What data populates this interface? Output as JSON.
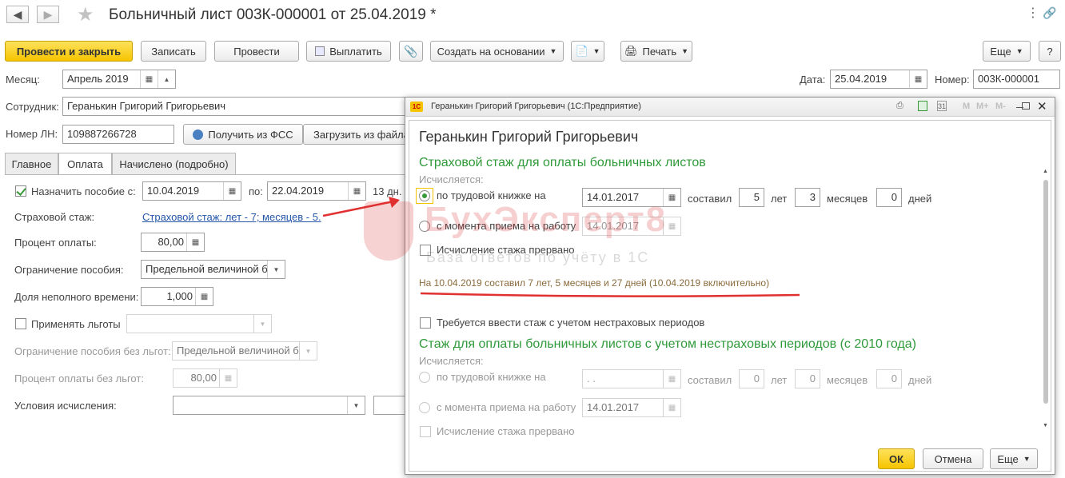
{
  "window": {
    "title": "Больничный лист 003К-000001 от 25.04.2019 *"
  },
  "toolbar": {
    "post_close": "Провести и закрыть",
    "save": "Записать",
    "post": "Провести",
    "pay": "Выплатить",
    "create_based": "Создать на основании",
    "print": "Печать",
    "more": "Еще",
    "help": "?"
  },
  "header": {
    "month_label": "Месяц:",
    "month_value": "Апрель 2019",
    "date_label": "Дата:",
    "date_value": "25.04.2019",
    "number_label": "Номер:",
    "number_value": "003К-000001",
    "employee_label": "Сотрудник:",
    "employee_value": "Геранькин Григорий Григорьевич",
    "ln_label": "Номер ЛН:",
    "ln_value": "109887266728",
    "get_fss": "Получить из ФСС",
    "load_file": "Загрузить из файла"
  },
  "tabs": [
    "Главное",
    "Оплата",
    "Начислено (подробно)"
  ],
  "payment": {
    "assign_label": "Назначить пособие с:",
    "assign_from": "10.04.2019",
    "to_label": "по:",
    "assign_to": "22.04.2019",
    "days": "13 дн.",
    "insurance_label": "Страховой стаж:",
    "insurance_link": "Страховой стаж: лет - 7; месяцев - 5.",
    "percent_label": "Процент оплаты:",
    "percent_value": "80,00",
    "limit_label": "Ограничение пособия:",
    "limit_value": "Предельной величиной ба",
    "parttime_label": "Доля неполного времени:",
    "parttime_value": "1,000",
    "benefits_label": "Применять льготы",
    "limit_nobenefit_label": "Ограничение пособия без льгот:",
    "limit_nobenefit_value": "Предельной величиной ба",
    "percent_nobenefit_label": "Процент оплаты без льгот:",
    "percent_nobenefit_value": "80,00",
    "conditions_label": "Условия исчисления:"
  },
  "dialog": {
    "title": "Геранькин Григорий Григорьевич  (1С:Предприятие)",
    "heading": "Геранькин Григорий Григорьевич",
    "section1": "Страховой стаж для оплаты больничных листов",
    "calculated": "Исчисляется:",
    "by_workbook": "по трудовой книжке на",
    "workbook_date": "14.01.2017",
    "made": "составил",
    "years_value": "5",
    "years_label": "лет",
    "months_value": "3",
    "months_label": "месяцев",
    "days_value": "0",
    "days_label": "дней",
    "from_hire": "с момента приема на работу",
    "hire_date": "14.01.2017",
    "interrupted": "Исчисление стажа прервано",
    "summary": "На 10.04.2019 составил 7 лет, 5 месяцев и 27 дней (10.04.2019 включительно)",
    "need_noninsurance": "Требуется ввести стаж с учетом нестраховых периодов",
    "section2": "Стаж для оплаты больничных листов с учетом нестраховых периодов (с 2010 года)",
    "calculated2": "Исчисляется:",
    "by_workbook2": "по трудовой книжке на",
    "workbook_date2": ". .",
    "made2": "составил",
    "years_value2": "0",
    "years_label2": "лет",
    "months_value2": "0",
    "months_label2": "месяцев",
    "days_value2": "0",
    "days_label2": "дней",
    "from_hire2": "с момента приема на работу",
    "hire_date2": "14.01.2017",
    "interrupted2": "Исчисление стажа прервано",
    "ok": "ОК",
    "cancel": "Отмена",
    "more": "Еще"
  },
  "watermark": {
    "brand": "БухЭксперт8",
    "tagline": "База ответов по учёту в 1С"
  },
  "colors": {
    "primary": "#f5c400",
    "green_heading": "#2f9a3a",
    "link": "#2456a7",
    "annotation": "#e03030"
  }
}
